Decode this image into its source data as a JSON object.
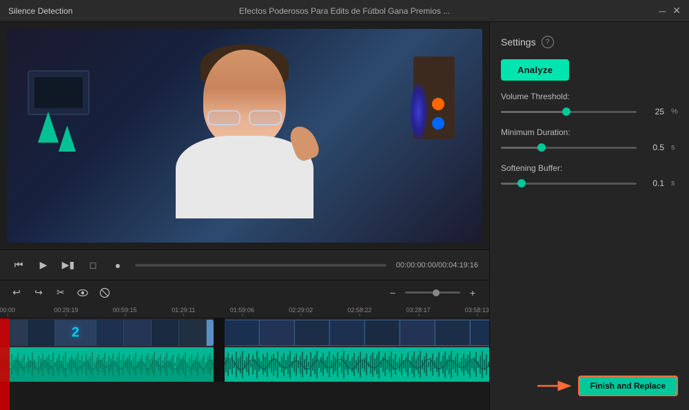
{
  "titleBar": {
    "appTitle": "Silence Detection",
    "videoTitle": "Efectos Poderosos Para Edits de Fútbol   Gana Premios ...",
    "minimizeLabel": "─",
    "closeLabel": "✕"
  },
  "settings": {
    "label": "Settings",
    "helpIcon": "?",
    "analyzeLabel": "Analyze",
    "volumeThreshold": {
      "label": "Volume Threshold:",
      "value": "25",
      "unit": "%",
      "percent": 48
    },
    "minimumDuration": {
      "label": "Minimum Duration:",
      "value": "0.5",
      "unit": "s",
      "percent": 30
    },
    "softeningBuffer": {
      "label": "Softening Buffer:",
      "value": "0.1",
      "unit": "s",
      "percent": 15
    }
  },
  "playback": {
    "timecode": "00:00:00:00/00:04:19:16"
  },
  "timeline": {
    "rulers": [
      {
        "label": "00:00",
        "posPercent": 1.5
      },
      {
        "label": "00:29:19",
        "posPercent": 13.5
      },
      {
        "label": "00:59:15",
        "posPercent": 25.5
      },
      {
        "label": "01:29:11",
        "posPercent": 37.5
      },
      {
        "label": "01:59:06",
        "posPercent": 49.5
      },
      {
        "label": "02:29:02",
        "posPercent": 61.5
      },
      {
        "label": "02:58:22",
        "posPercent": 73.5
      },
      {
        "label": "03:28:17",
        "posPercent": 85.5
      },
      {
        "label": "03:58:13",
        "posPercent": 97.5
      }
    ]
  },
  "finishButton": {
    "label": "Finish and Replace"
  },
  "toolbar": {
    "undoIcon": "↩",
    "redoIcon": "↪",
    "scissorsIcon": "✂",
    "eyeIcon": "👁",
    "muteIcon": "⊘",
    "minusIcon": "−",
    "plusIcon": "+"
  }
}
